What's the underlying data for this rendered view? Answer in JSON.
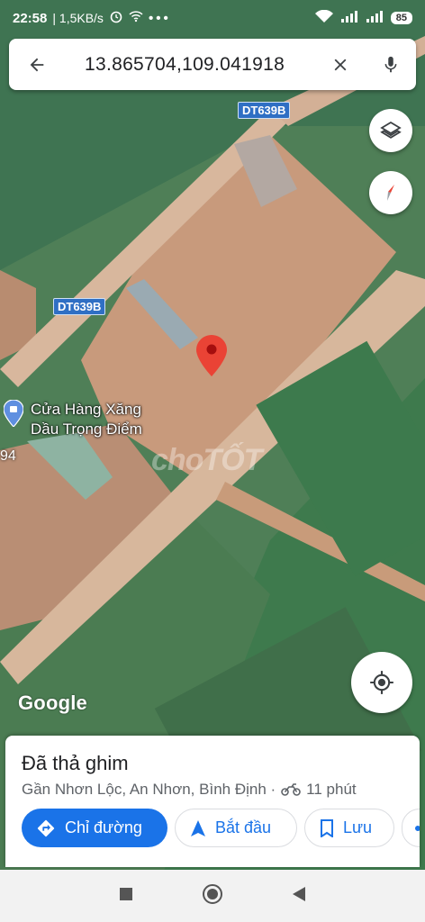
{
  "status_bar": {
    "time": "22:58",
    "speed": "| 1,5KB/s",
    "battery": "85"
  },
  "search": {
    "query": "13.865704,109.041918"
  },
  "map": {
    "road_labels": [
      "DT639B",
      "DT639B"
    ],
    "place_name_line1": "Cửa Hàng Xăng",
    "place_name_line2": "Dầu Trọng Điểm",
    "partial_number": "94",
    "watermark": "choTỐT",
    "attribution": "Google"
  },
  "sheet": {
    "title": "Đã thả ghim",
    "address": "Gần Nhơn Lộc, An Nhơn, Bình Định ·",
    "travel_time": "11 phút",
    "directions_label": "Chỉ đường",
    "start_label": "Bắt đầu",
    "save_label": "Lưu"
  },
  "colors": {
    "accent": "#1a73e8",
    "pin": "#ea4335",
    "road_label_bg": "#2f6fc4"
  },
  "icons": {
    "back": "back-arrow-icon",
    "close": "close-icon",
    "mic": "mic-icon",
    "layers": "layers-icon",
    "compass": "compass-icon",
    "my_location": "my-location-icon",
    "motorbike": "motorbike-icon",
    "directions": "directions-icon",
    "navigate": "navigate-arrow-icon",
    "bookmark": "bookmark-icon"
  }
}
